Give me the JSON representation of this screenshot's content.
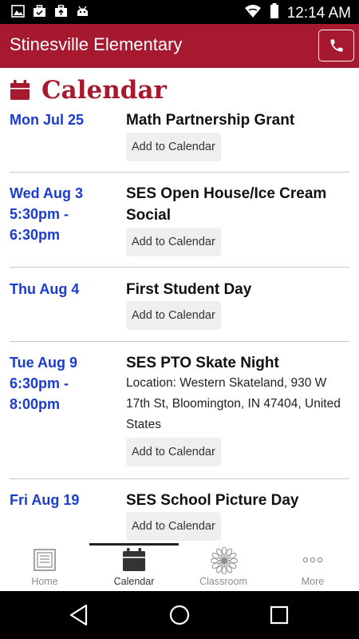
{
  "status_bar": {
    "time": "12:14 AM",
    "icons_left": [
      "image-icon",
      "briefcase-check-icon",
      "briefcase-upload-icon",
      "android-icon"
    ],
    "icons_right": [
      "wifi-icon",
      "battery-icon"
    ]
  },
  "app_bar": {
    "title": "Stinesville Elementary",
    "call_icon": "phone-icon",
    "color": "#a6192e"
  },
  "section": {
    "title": "Calendar",
    "icon": "calendar-icon"
  },
  "events": [
    {
      "date_lines": [
        "Mon Jul 25"
      ],
      "title": "Math Partnership Grant",
      "location": "",
      "button": "Add to Calendar"
    },
    {
      "date_lines": [
        "Wed Aug 3",
        "5:30pm -",
        "6:30pm"
      ],
      "title": "SES Open House/Ice Cream Social",
      "location": "",
      "button": "Add to Calendar"
    },
    {
      "date_lines": [
        "Thu Aug 4"
      ],
      "title": "First Student Day",
      "location": "",
      "button": "Add to Calendar"
    },
    {
      "date_lines": [
        "Tue Aug 9",
        "6:30pm -",
        "8:00pm"
      ],
      "title": "SES PTO Skate Night",
      "location": "Location: Western Skateland, 930 W 17th St, Bloomington, IN 47404, United States",
      "button": "Add to Calendar"
    },
    {
      "date_lines": [
        "Fri Aug 19"
      ],
      "title": "SES School Picture Day",
      "location": "",
      "button": "Add to Calendar"
    }
  ],
  "tabs": [
    {
      "label": "Home",
      "icon": "document-icon",
      "active": false
    },
    {
      "label": "Calendar",
      "icon": "calendar-icon",
      "active": true
    },
    {
      "label": "Classroom",
      "icon": "flower-icon",
      "active": false
    },
    {
      "label": "More",
      "icon": "ellipsis-icon",
      "active": false
    }
  ],
  "nav_bar": {
    "icons": [
      "back-icon",
      "home-circle-icon",
      "recents-icon"
    ]
  },
  "colors": {
    "accent": "#a6192e",
    "date": "#1a3ccf",
    "divider": "#c8c8c8"
  }
}
